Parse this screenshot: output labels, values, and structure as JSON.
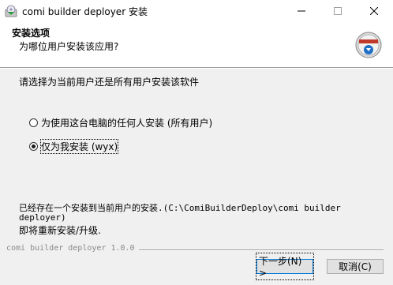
{
  "window": {
    "title": "comi builder deployer 安装"
  },
  "header": {
    "title": "安装选项",
    "subtitle": "为哪位用户安装该应用?"
  },
  "content": {
    "prompt": "请选择为当前用户还是所有用户安装该软件",
    "options": [
      {
        "label": "为使用这台电脑的任何人安装 (所有用户)",
        "selected": false
      },
      {
        "label": "仅为我安装 (wyx)",
        "selected": true
      }
    ],
    "info_line1": "已经存在一个安装到当前用户的安装.(C:\\ComiBuilderDeploy\\comi builder deployer)",
    "info_line2": "即将重新安装/升级."
  },
  "footer": {
    "brand": "comi builder deployer 1.0.0",
    "next_label": "下一步(N) >",
    "cancel_label": "取消(C)"
  },
  "icons": {
    "app": "setup-cd-icon",
    "logo": "installer-badge-icon",
    "minimize": "minimize-icon",
    "maximize": "maximize-icon",
    "close": "close-icon"
  },
  "colors": {
    "title_bar": "#ffffff",
    "dialog_bg": "#f0f0f0",
    "button_focus_border": "#0078d7",
    "brand_text": "#8a8a8a"
  }
}
